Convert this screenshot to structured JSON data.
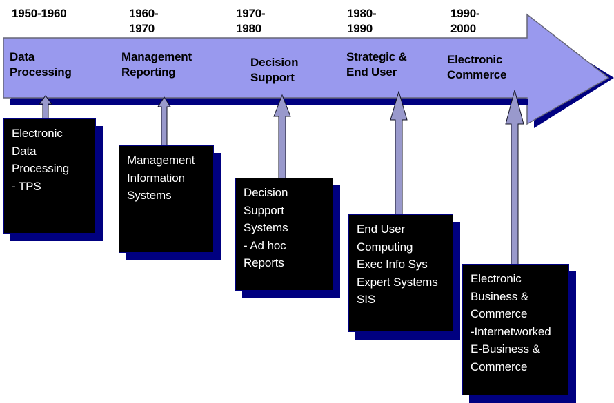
{
  "diagram": {
    "title": "Evolution of Information Systems Timeline",
    "colors": {
      "arrow_fill": "#9999ee",
      "arrow_outline": "#555566",
      "arrow_shadow": "#000080",
      "box_fill": "#000000",
      "box_shadow": "#000080",
      "box_text": "#ffffff",
      "connector_fill": "#9999cc",
      "connector_outline": "#000000",
      "page_background": "#ffffff",
      "label_text": "#000000"
    },
    "eras": [
      {
        "date": "1950-1960",
        "label": "Data\nProcessing",
        "detail": "Electronic\nData\nProcessing\n- TPS"
      },
      {
        "date": "1960-\n1970",
        "label": "Management\nReporting",
        "detail": "Management\nInformation\nSystems"
      },
      {
        "date": "1970-\n1980",
        "label": "Decision\nSupport",
        "detail": "Decision\nSupport\nSystems\n- Ad hoc\nReports"
      },
      {
        "date": "1980-\n1990",
        "label": "Strategic &\nEnd User",
        "detail": "End User\nComputing\nExec Info Sys\nExpert Systems\nSIS"
      },
      {
        "date": "1990-\n2000",
        "label": "Electronic\nCommerce",
        "detail": "Electronic\nBusiness &\nCommerce\n-Internetworked\nE-Business &\nCommerce"
      }
    ]
  }
}
